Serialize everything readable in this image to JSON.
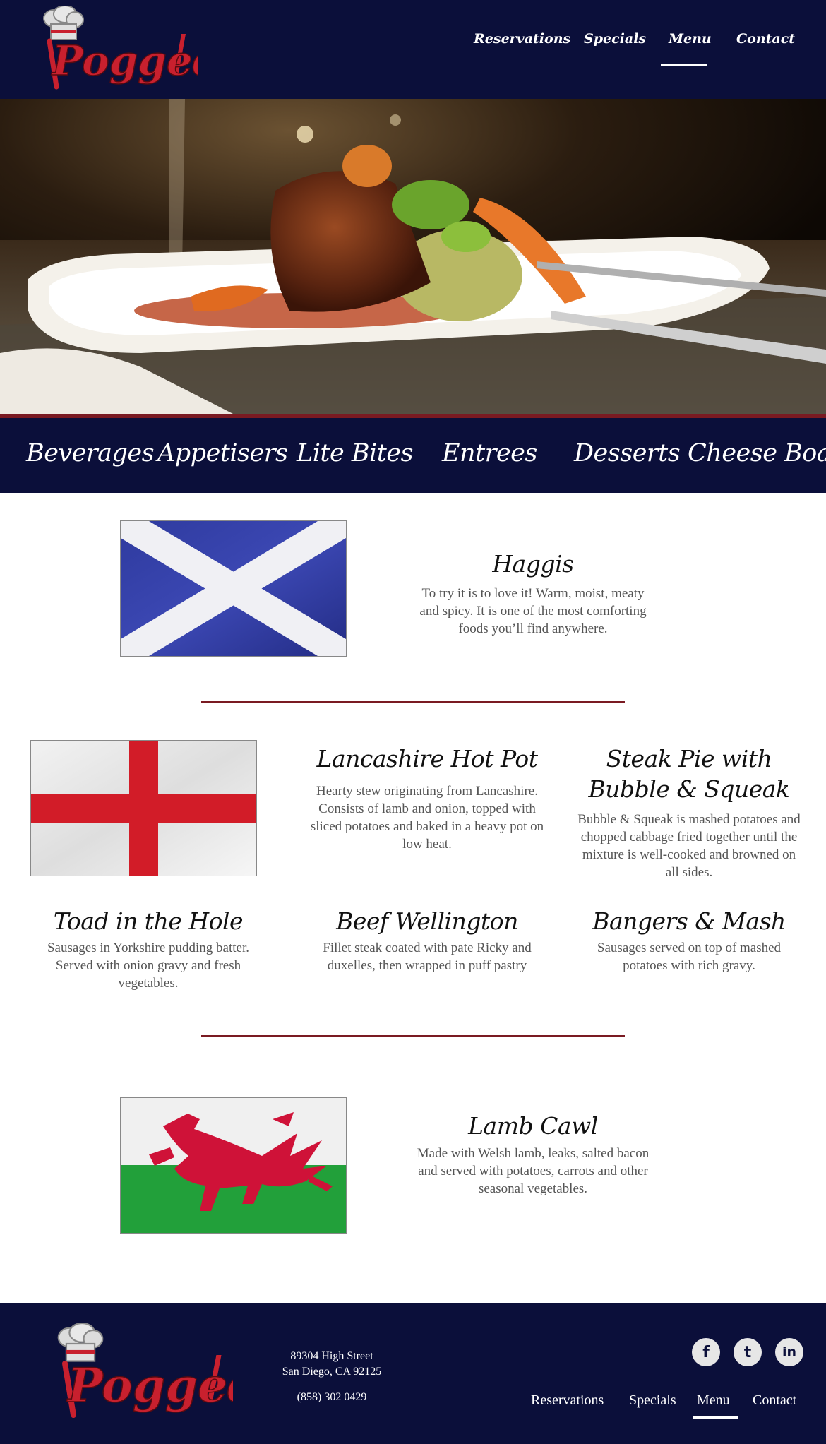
{
  "brand": {
    "logo_text": "Pogged"
  },
  "nav": {
    "items": [
      {
        "label": "Reservations"
      },
      {
        "label": "Specials"
      },
      {
        "label": "Menu"
      },
      {
        "label": "Contact"
      }
    ],
    "active": "Menu"
  },
  "categories": [
    "Beverages",
    "Appetisers",
    "Lite Bites",
    "Entrees",
    "Desserts",
    "Cheese Board"
  ],
  "dishes": {
    "haggis": {
      "title": "Haggis",
      "description": "To try it is to love it!  Warm, moist, meaty and spicy.  It is one of the most comforting foods you’ll find anywhere."
    },
    "hotpot": {
      "title": "Lancashire Hot Pot",
      "description": "Hearty stew originating from Lancashire. Consists of lamb and onion, topped with sliced potatoes and baked in a heavy pot on low heat."
    },
    "steakpie": {
      "title_line1": "Steak Pie with",
      "title_line2": "Bubble & Squeak",
      "description": "Bubble & Squeak is mashed potatoes and chopped cabbage fried together until the mixture is well-cooked and browned on all sides."
    },
    "toad": {
      "title": "Toad in the Hole",
      "description": "Sausages in Yorkshire pudding batter. Served with onion gravy and fresh vegetables."
    },
    "wellington": {
      "title": "Beef Wellington",
      "description": "Fillet steak coated with pate Ricky and duxelles, then wrapped in puff pastry"
    },
    "bangers": {
      "title": "Bangers & Mash",
      "description": "Sausages served on top of mashed potatoes with rich gravy."
    },
    "lambcawl": {
      "title": "Lamb Cawl",
      "description": "Made with Welsh lamb, leaks, salted bacon and served with potatoes, carrots and other seasonal vegetables."
    }
  },
  "footer": {
    "address_line1": "89304 High Street",
    "address_line2": "San Diego, CA 92125",
    "phone": "(858) 302 0429",
    "social": [
      {
        "icon": "facebook-icon",
        "glyph": "f"
      },
      {
        "icon": "twitter-icon",
        "glyph": "t"
      },
      {
        "icon": "linkedin-icon",
        "glyph": "in"
      }
    ]
  },
  "colors": {
    "navy": "#0b0f3a",
    "accent_red": "#7a1a22",
    "logo_red": "#c8202e"
  }
}
